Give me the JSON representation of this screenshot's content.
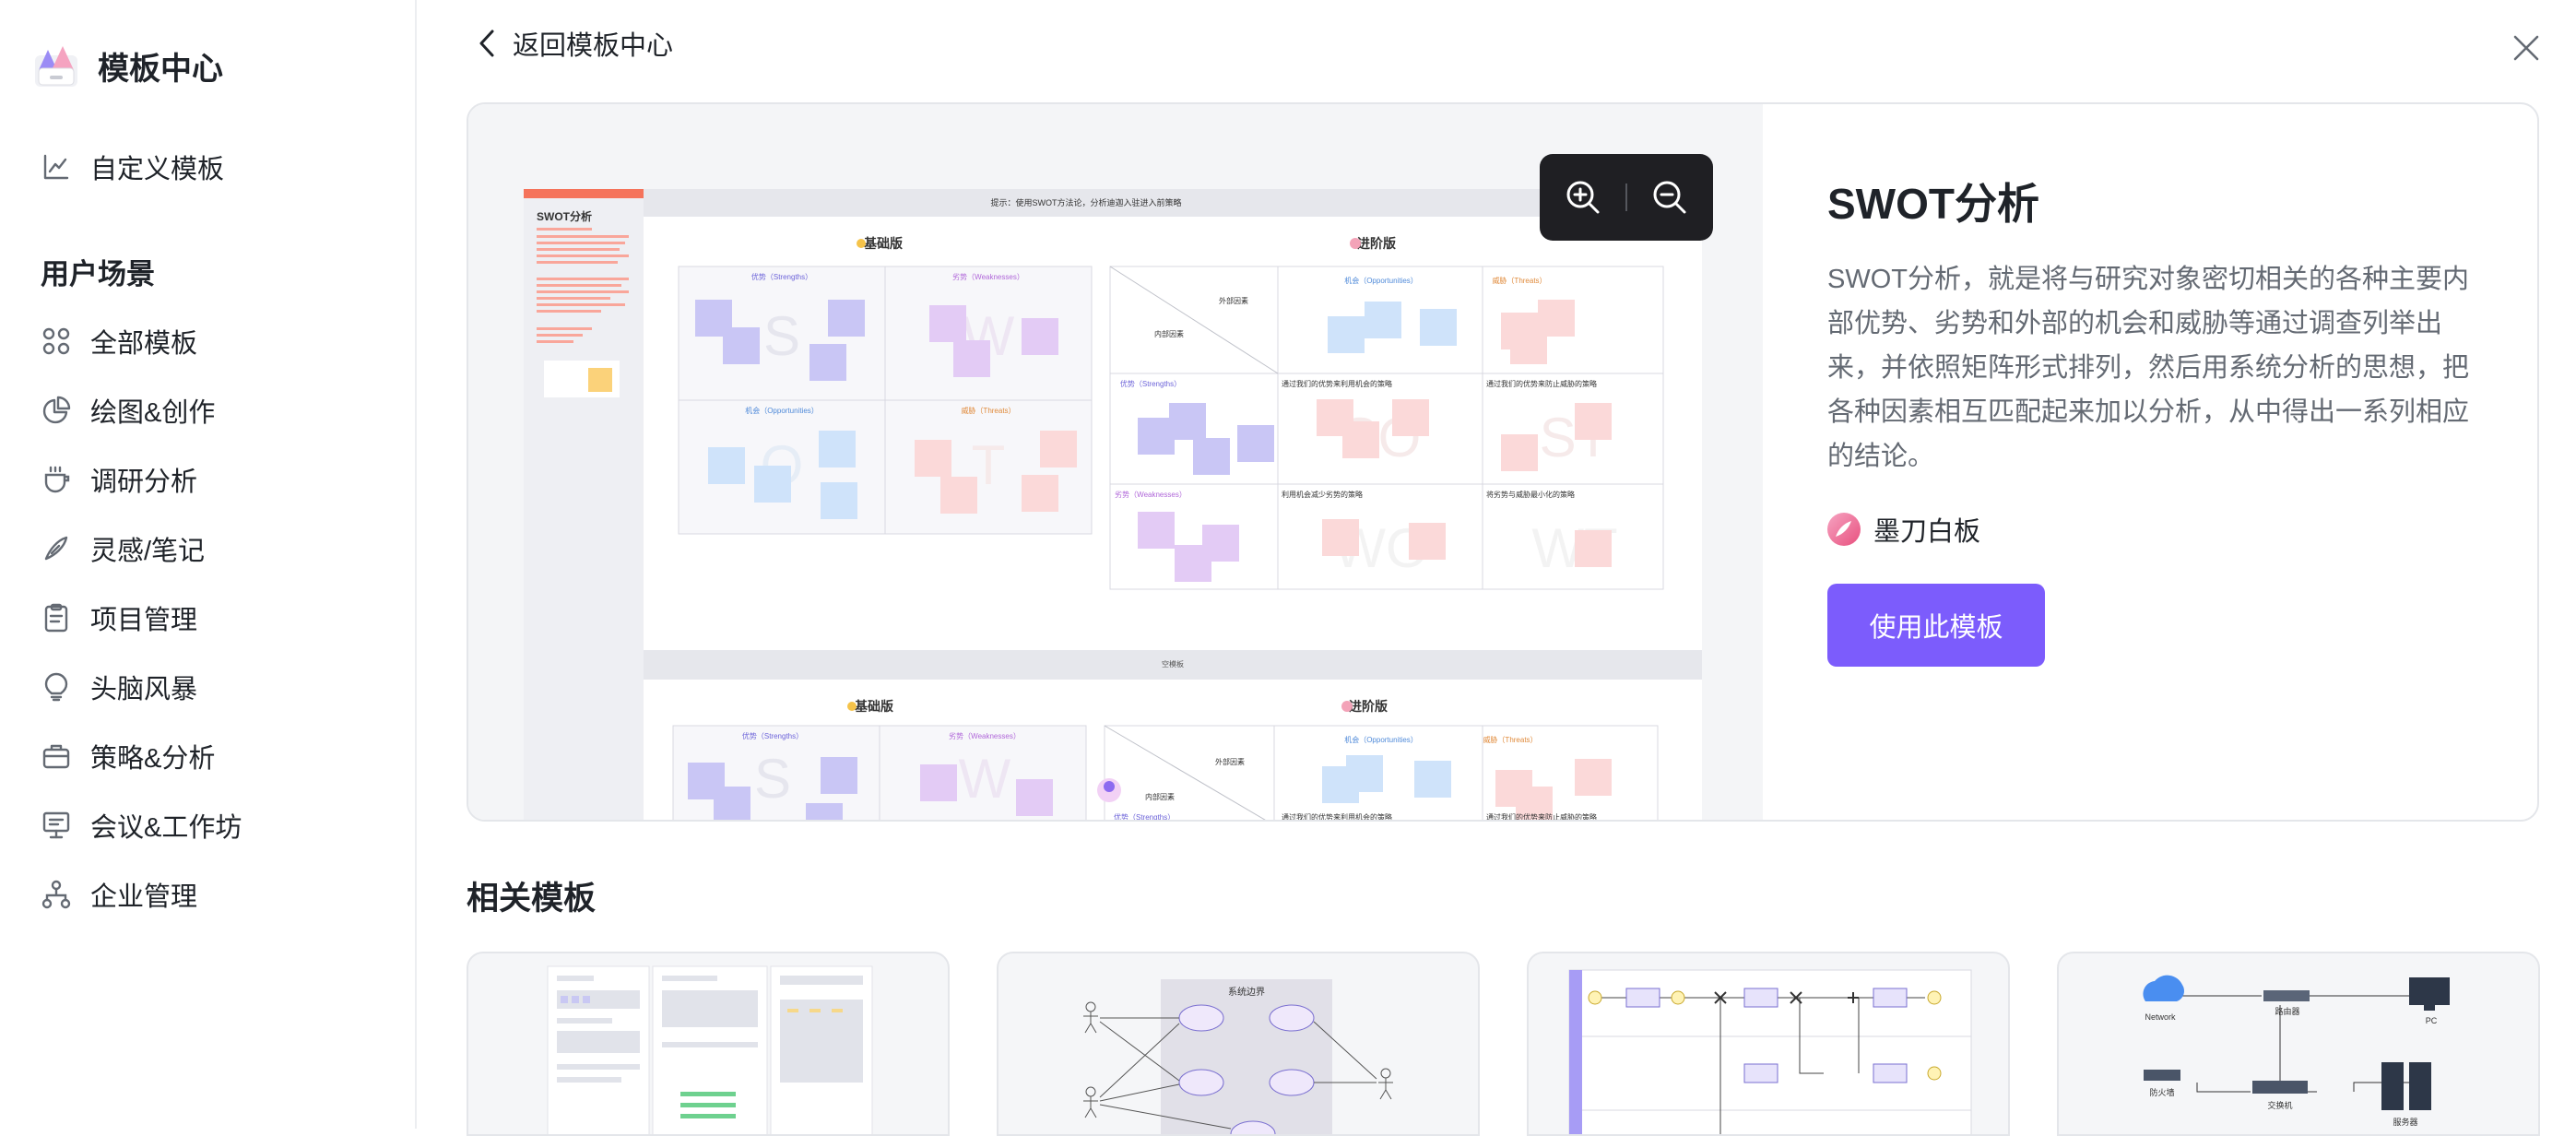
{
  "sidebar": {
    "title": "模板中心",
    "custom": "自定义模板",
    "section": "用户场景",
    "items": [
      {
        "label": "全部模板",
        "icon": "grid-icon"
      },
      {
        "label": "绘图&创作",
        "icon": "pie-chart-icon"
      },
      {
        "label": "调研分析",
        "icon": "cup-icon"
      },
      {
        "label": "灵感/笔记",
        "icon": "pen-icon"
      },
      {
        "label": "项目管理",
        "icon": "clipboard-icon"
      },
      {
        "label": "头脑风暴",
        "icon": "lightbulb-icon"
      },
      {
        "label": "策略&分析",
        "icon": "briefcase-icon"
      },
      {
        "label": "会议&工作坊",
        "icon": "presentation-icon"
      },
      {
        "label": "企业管理",
        "icon": "org-chart-icon"
      }
    ]
  },
  "header": {
    "back_label": "返回模板中心"
  },
  "template": {
    "title": "SWOT分析",
    "description": "SWOT分析，就是将与研究对象密切相关的各种主要内部优势、劣势和外部的机会和威胁等通过调查列举出来，并依照矩阵形式排列，然后用系统分析的思想，把各种因素相互匹配起来加以分析，从中得出一系列相应的结论。",
    "author": "墨刀白板",
    "use_button": "使用此模板"
  },
  "preview": {
    "tip": "提示：使用SWOT方法论，分析迪迦入驻进入前策略",
    "sheet_title": "SWOT分析",
    "basic_label": "基础版",
    "advanced_label": "进阶版",
    "blank_label": "空模板",
    "strength": "优势（Strengths）",
    "weakness": "劣势（Weaknesses）",
    "opportunity": "机会（Opportunities）",
    "threat": "威胁（Threats）",
    "external": "外部因素",
    "internal": "内部因素",
    "so_text": "通过我们的优势来利用机会的策略",
    "st_text": "通过我们的优势来防止威胁的策略",
    "wo_text": "利用机会减少劣势的策略",
    "wt_text": "将劣势与威胁最小化的策略"
  },
  "related": {
    "title": "相关模板",
    "card2_title": "系统边界",
    "card4_labels": [
      "Network",
      "路由器",
      "PC",
      "防火墙",
      "交换机",
      "服务器"
    ]
  },
  "colors": {
    "accent": "#7c5cfc",
    "strength": "#c9c6f5",
    "weakness": "#e3cbf5",
    "opportunity": "#cfe3fa",
    "threat": "#fbd9d9"
  }
}
